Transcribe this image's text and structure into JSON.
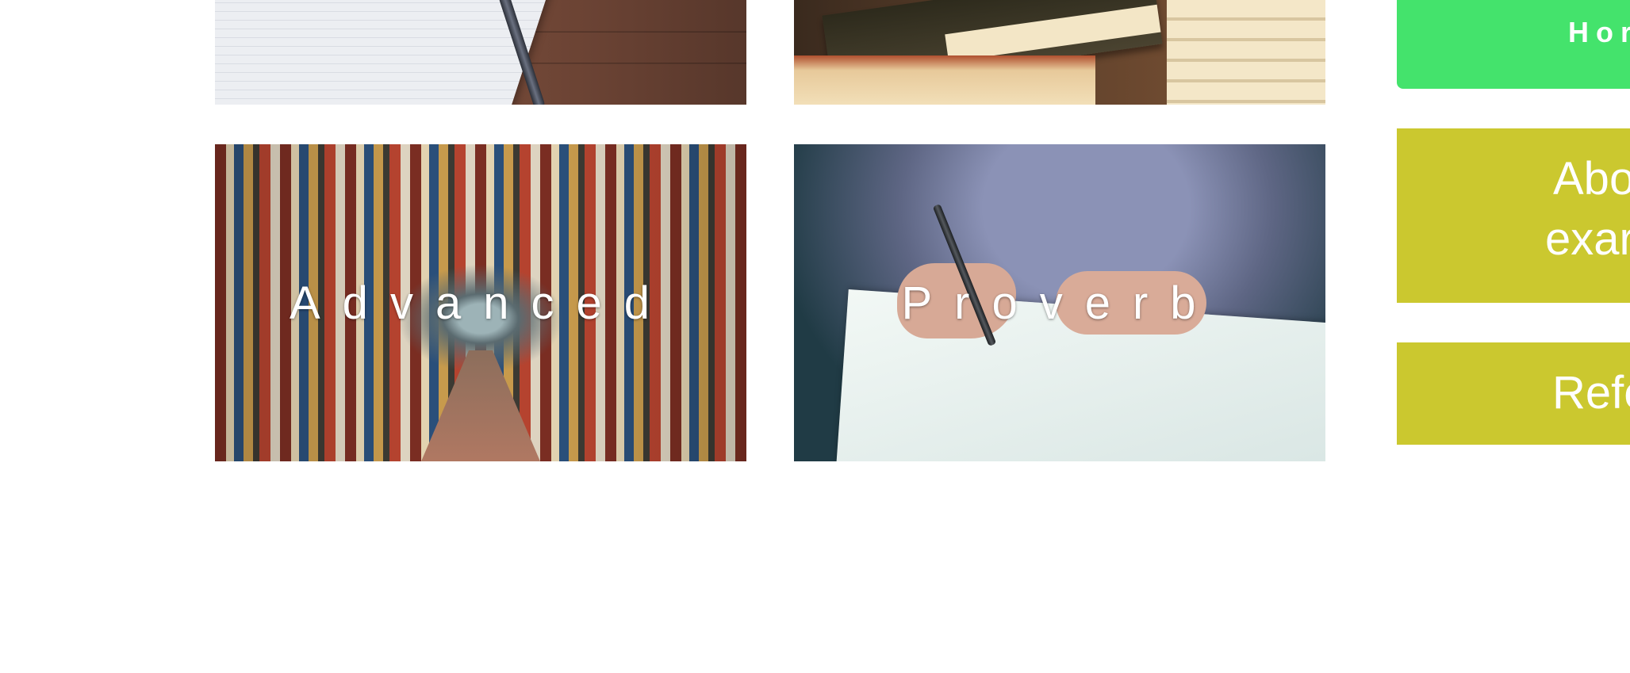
{
  "gallery": {
    "cards": [
      {
        "id": "notebook",
        "caption": ""
      },
      {
        "id": "books",
        "caption": ""
      },
      {
        "id": "library",
        "caption": "Advanced"
      },
      {
        "id": "writing",
        "caption": "Proverb"
      }
    ]
  },
  "sidebar": {
    "home_top": "…",
    "home_label": "Hor",
    "about_line1": "Abo",
    "about_line2": "exar",
    "reference_label": "Refe"
  },
  "colors": {
    "home_green": "#44e36c",
    "olive": "#cbc82f",
    "background": "#ffffff"
  }
}
